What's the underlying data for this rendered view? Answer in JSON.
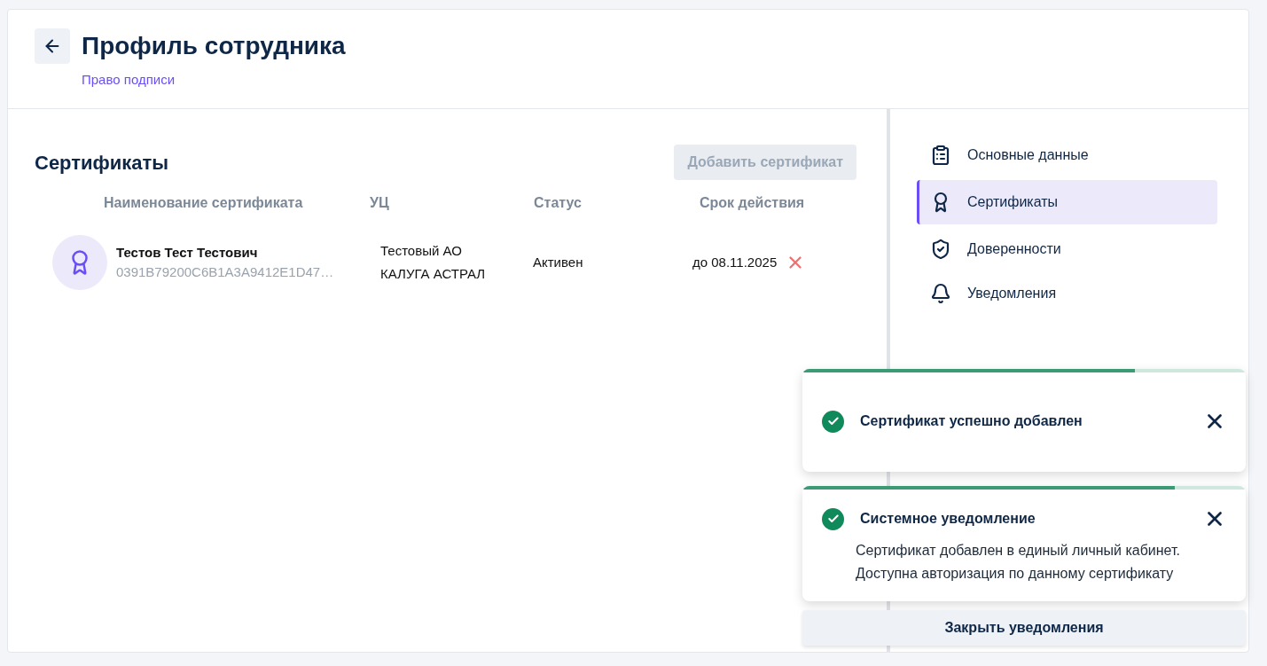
{
  "header": {
    "title": "Профиль сотрудника",
    "subtitle": "Право подписи"
  },
  "section": {
    "title": "Сертификаты",
    "add_button": {
      "label": "Добавить сертификат",
      "disabled": true
    }
  },
  "table": {
    "columns": [
      "Наименование сертификата",
      "УЦ",
      "Статус",
      "Срок действия"
    ],
    "rows": [
      {
        "name": "Тестов Тест Тестович",
        "serial": "0391B79200C6B1A3A9412E1D47…",
        "ca": [
          "Тестовый АО",
          "КАЛУГА АСТРАЛ"
        ],
        "status": "Активен",
        "validity": "до 08.11.2025"
      }
    ]
  },
  "sidebar": {
    "items": [
      {
        "label": "Основные данные",
        "selected": false
      },
      {
        "label": "Сертификаты",
        "selected": true
      },
      {
        "label": "Доверенности",
        "selected": false
      },
      {
        "label": "Уведомления",
        "selected": false
      }
    ]
  },
  "toasts": [
    {
      "title": "Сертификат успешно добавлен",
      "level": 0.75
    },
    {
      "title": "Системное уведомление",
      "body": [
        "Сертификат добавлен в единый личный кабинет.",
        "Доступна авторизация по данному сертификату"
      ],
      "level": 0.84
    }
  ],
  "close_all_button": "Закрыть уведомления"
}
